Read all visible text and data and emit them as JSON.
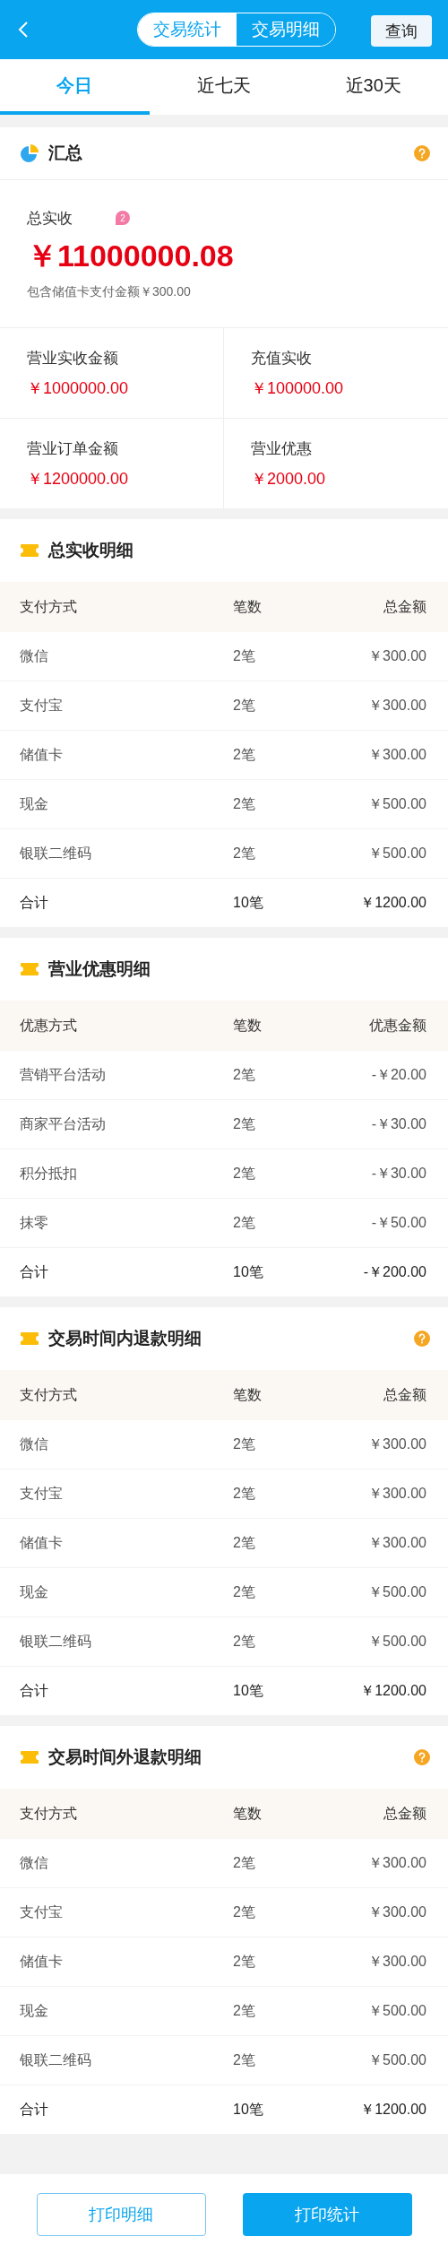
{
  "header": {
    "segments": [
      {
        "label": "交易统计",
        "selected": true
      },
      {
        "label": "交易明细",
        "selected": false
      }
    ],
    "query_button": "查询"
  },
  "tabs": [
    {
      "label": "今日",
      "selected": true
    },
    {
      "label": "近七天",
      "selected": false
    },
    {
      "label": "近30天",
      "selected": false
    }
  ],
  "summary": {
    "title": "汇总",
    "help": true,
    "total_label": "总实收",
    "badge": "2",
    "total_amount": "￥11000000.08",
    "note": "包含储值卡支付金额￥300.00",
    "items": [
      {
        "label": "营业实收金额",
        "value": "￥1000000.00"
      },
      {
        "label": "充值实收",
        "value": "￥100000.00"
      },
      {
        "label": "营业订单金额",
        "value": "￥1200000.00"
      },
      {
        "label": "营业优惠",
        "value": "￥2000.00"
      }
    ]
  },
  "sections": [
    {
      "title": "总实收明细",
      "help": false,
      "columns": [
        "支付方式",
        "笔数",
        "总金额"
      ],
      "rows": [
        [
          "微信",
          "2笔",
          "￥300.00"
        ],
        [
          "支付宝",
          "2笔",
          "￥300.00"
        ],
        [
          "储值卡",
          "2笔",
          "￥300.00"
        ],
        [
          "现金",
          "2笔",
          "￥500.00"
        ],
        [
          "银联二维码",
          "2笔",
          "￥500.00"
        ]
      ],
      "total": [
        "合计",
        "10笔",
        "￥1200.00"
      ]
    },
    {
      "title": "营业优惠明细",
      "help": false,
      "columns": [
        "优惠方式",
        "笔数",
        "优惠金额"
      ],
      "rows": [
        [
          "营销平台活动",
          "2笔",
          "-￥20.00"
        ],
        [
          "商家平台活动",
          "2笔",
          "-￥30.00"
        ],
        [
          "积分抵扣",
          "2笔",
          "-￥30.00"
        ],
        [
          "抹零",
          "2笔",
          "-￥50.00"
        ]
      ],
      "total": [
        "合计",
        "10笔",
        "-￥200.00"
      ]
    },
    {
      "title": "交易时间内退款明细",
      "help": true,
      "columns": [
        "支付方式",
        "笔数",
        "总金额"
      ],
      "rows": [
        [
          "微信",
          "2笔",
          "￥300.00"
        ],
        [
          "支付宝",
          "2笔",
          "￥300.00"
        ],
        [
          "储值卡",
          "2笔",
          "￥300.00"
        ],
        [
          "现金",
          "2笔",
          "￥500.00"
        ],
        [
          "银联二维码",
          "2笔",
          "￥500.00"
        ]
      ],
      "total": [
        "合计",
        "10笔",
        "￥1200.00"
      ]
    },
    {
      "title": "交易时间外退款明细",
      "help": true,
      "columns": [
        "支付方式",
        "笔数",
        "总金额"
      ],
      "rows": [
        [
          "微信",
          "2笔",
          "￥300.00"
        ],
        [
          "支付宝",
          "2笔",
          "￥300.00"
        ],
        [
          "储值卡",
          "2笔",
          "￥300.00"
        ],
        [
          "现金",
          "2笔",
          "￥500.00"
        ],
        [
          "银联二维码",
          "2笔",
          "￥500.00"
        ]
      ],
      "total": [
        "合计",
        "10笔",
        "￥1200.00"
      ]
    }
  ],
  "footer": {
    "buttons": [
      {
        "label": "打印明细",
        "kind": "outline"
      },
      {
        "label": "打印统计",
        "kind": "primary"
      }
    ]
  }
}
